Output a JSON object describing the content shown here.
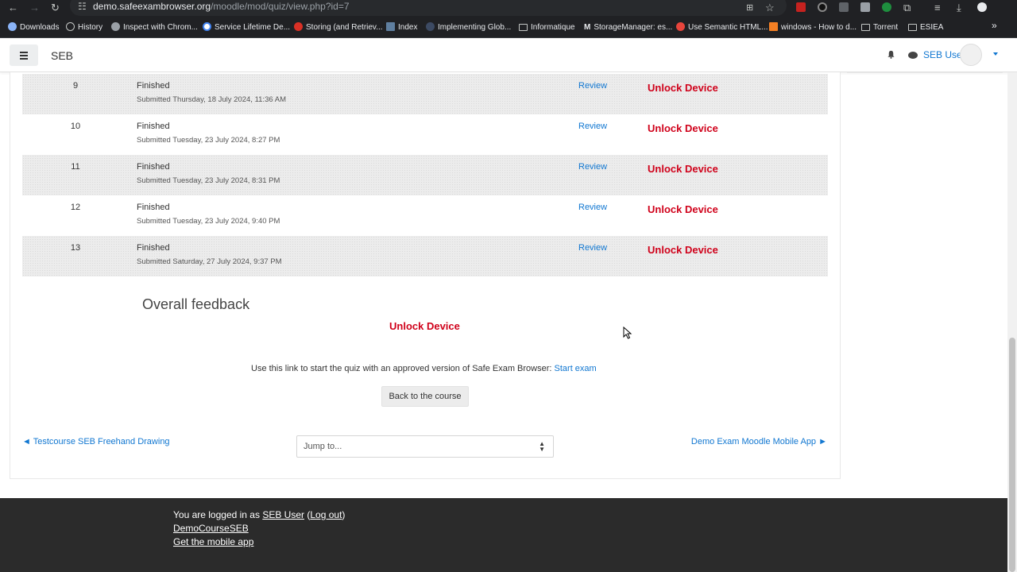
{
  "browser": {
    "url_host": "demo.safeexambrowser.org",
    "url_path": "/moodle/mod/quiz/view.php?id=7",
    "bookmarks": [
      "Downloads",
      "History",
      "Inspect with Chrom...",
      "Service Lifetime De...",
      "Storing (and Retriev...",
      "Index",
      "Implementing Glob...",
      "Informatique",
      "StorageManager: es...",
      "Use Semantic HTML...",
      "windows - How to d...",
      "Torrent",
      "ESIEA"
    ]
  },
  "navbar": {
    "brand": "SEB",
    "user_name": "SEB User"
  },
  "attempts": [
    {
      "num": "9",
      "state": "Finished",
      "submitted": "Submitted Thursday, 18 July 2024, 11:36 AM",
      "review": "Review",
      "unlock": "Unlock Device"
    },
    {
      "num": "10",
      "state": "Finished",
      "submitted": "Submitted Tuesday, 23 July 2024, 8:27 PM",
      "review": "Review",
      "unlock": "Unlock Device"
    },
    {
      "num": "11",
      "state": "Finished",
      "submitted": "Submitted Tuesday, 23 July 2024, 8:31 PM",
      "review": "Review",
      "unlock": "Unlock Device"
    },
    {
      "num": "12",
      "state": "Finished",
      "submitted": "Submitted Tuesday, 23 July 2024, 9:40 PM",
      "review": "Review",
      "unlock": "Unlock Device"
    },
    {
      "num": "13",
      "state": "Finished",
      "submitted": "Submitted Saturday, 27 July 2024, 9:37 PM",
      "review": "Review",
      "unlock": "Unlock Device"
    }
  ],
  "feedback": {
    "title": "Overall feedback",
    "unlock": "Unlock Device",
    "seb_text": "Use this link to start the quiz with an approved version of Safe Exam Browser:",
    "seb_link": "Start exam",
    "back_button": "Back to the course"
  },
  "activity_nav": {
    "prev": "◄ Testcourse SEB Freehand Drawing",
    "jump_placeholder": "Jump to...",
    "next": "Demo Exam Moodle Mobile App ►"
  },
  "footer": {
    "logged_in_prefix": "You are logged in as",
    "user_link": "SEB User",
    "logout_link": "Log out",
    "course_link": "DemoCourseSEB",
    "mobile_link": "Get the mobile app"
  }
}
